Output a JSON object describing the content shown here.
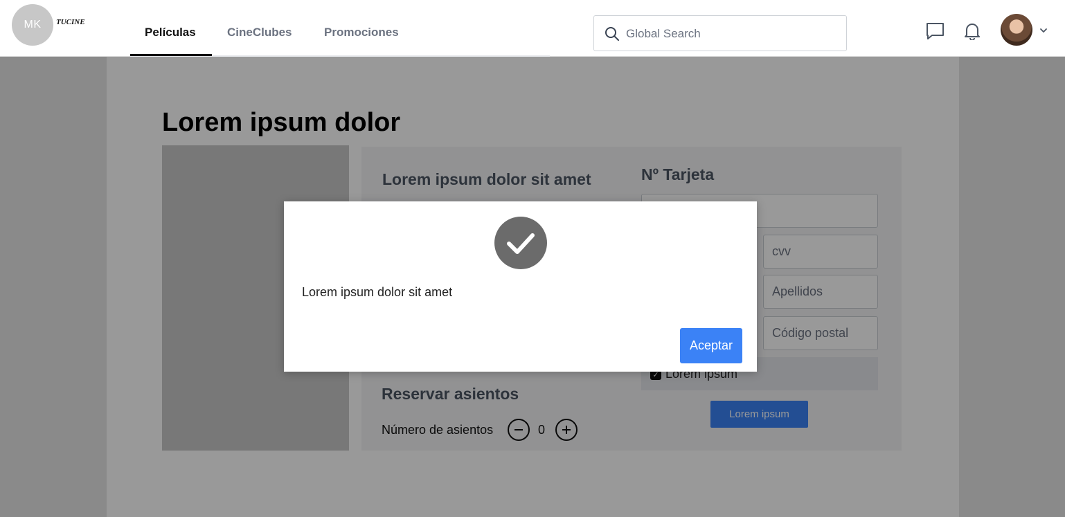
{
  "header": {
    "logo_initials": "MK",
    "brand_name": "TUCINE",
    "tabs": [
      {
        "label": "Películas",
        "active": true
      },
      {
        "label": "CineClubes",
        "active": false
      },
      {
        "label": "Promociones",
        "active": false
      }
    ],
    "search": {
      "placeholder": "Global Search"
    },
    "icons": [
      "chat-icon",
      "bell-icon",
      "avatar",
      "chevron-down-icon"
    ]
  },
  "page": {
    "title": "Lorem ipsum dolor",
    "section_heading": "Lorem ipsum dolor sit amet",
    "card_heading": "Nº Tarjeta",
    "fields": {
      "card_number": "",
      "cvv": "cvv",
      "apellidos": "Apellidos",
      "codigo_postal": "Código postal"
    },
    "checkbox": {
      "label": "Lorem ipsum",
      "checked": true
    },
    "submit_label": "Lorem ipsum",
    "seats": {
      "heading": "Reservar asientos",
      "label": "Número de asientos",
      "count": "0"
    }
  },
  "modal": {
    "icon": "check-icon",
    "message": "Lorem ipsum dolor sit amet",
    "accept_label": "Aceptar"
  },
  "colors": {
    "accent": "#3b82f6",
    "overlay": "rgba(0,0,0,0.40)"
  }
}
